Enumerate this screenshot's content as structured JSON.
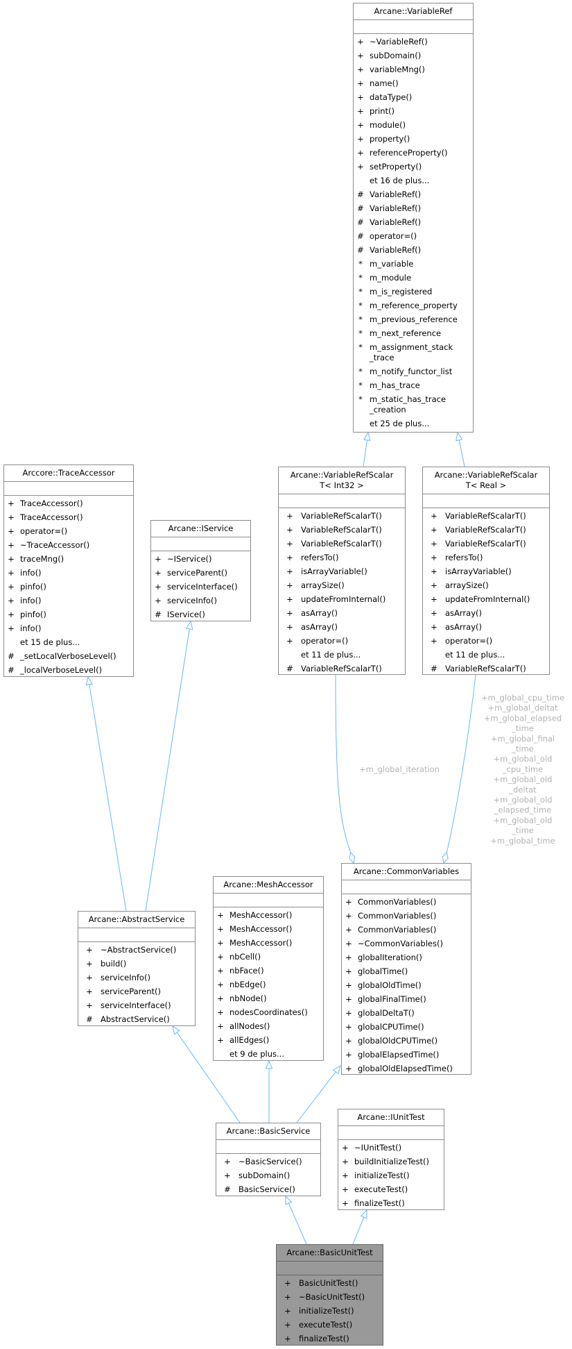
{
  "colors": {
    "edge": "#63b8ff",
    "focus_fill": "#999999",
    "border": "#8c8c8c",
    "label": "#b3b3b3"
  },
  "classes": {
    "variable_ref": {
      "title": "Arcane::VariableRef",
      "members": [
        [
          "+",
          "~VariableRef()"
        ],
        [
          "+",
          "subDomain()"
        ],
        [
          "+",
          "variableMng()"
        ],
        [
          "+",
          "name()"
        ],
        [
          "+",
          "dataType()"
        ],
        [
          "+",
          "print()"
        ],
        [
          "+",
          "module()"
        ],
        [
          "+",
          "property()"
        ],
        [
          "+",
          "referenceProperty()"
        ],
        [
          "+",
          "setProperty()"
        ],
        [
          "",
          "et 16 de plus..."
        ],
        [
          "#",
          "VariableRef()"
        ],
        [
          "#",
          "VariableRef()"
        ],
        [
          "#",
          "VariableRef()"
        ],
        [
          "#",
          "operator=()"
        ],
        [
          "#",
          "VariableRef()"
        ],
        [
          "*",
          "m_variable"
        ],
        [
          "*",
          "m_module"
        ],
        [
          "*",
          "m_is_registered"
        ],
        [
          "*",
          "m_reference_property"
        ],
        [
          "*",
          "m_previous_reference"
        ],
        [
          "*",
          "m_next_reference"
        ],
        [
          "*",
          "m_assignment_stack\n_trace"
        ],
        [
          "*",
          "m_notify_functor_list"
        ],
        [
          "*",
          "m_has_trace"
        ],
        [
          "*",
          "m_static_has_trace\n_creation"
        ],
        [
          "",
          "et 25 de plus..."
        ]
      ]
    },
    "scalar_int32": {
      "title": "Arcane::VariableRefScalar\nT< Int32 >",
      "members": [
        [
          "+",
          "VariableRefScalarT()"
        ],
        [
          "+",
          "VariableRefScalarT()"
        ],
        [
          "+",
          "VariableRefScalarT()"
        ],
        [
          "+",
          "refersTo()"
        ],
        [
          "+",
          "isArrayVariable()"
        ],
        [
          "+",
          "arraySize()"
        ],
        [
          "+",
          "updateFromInternal()"
        ],
        [
          "+",
          "asArray()"
        ],
        [
          "+",
          "asArray()"
        ],
        [
          "+",
          "operator=()"
        ],
        [
          "",
          "et 11 de plus..."
        ],
        [
          "#",
          "VariableRefScalarT()"
        ]
      ]
    },
    "scalar_real": {
      "title": "Arcane::VariableRefScalar\nT< Real >",
      "members": [
        [
          "+",
          "VariableRefScalarT()"
        ],
        [
          "+",
          "VariableRefScalarT()"
        ],
        [
          "+",
          "VariableRefScalarT()"
        ],
        [
          "+",
          "refersTo()"
        ],
        [
          "+",
          "isArrayVariable()"
        ],
        [
          "+",
          "arraySize()"
        ],
        [
          "+",
          "updateFromInternal()"
        ],
        [
          "+",
          "asArray()"
        ],
        [
          "+",
          "asArray()"
        ],
        [
          "+",
          "operator=()"
        ],
        [
          "",
          "et 11 de plus..."
        ],
        [
          "#",
          "VariableRefScalarT()"
        ]
      ]
    },
    "trace_accessor": {
      "title": "Arccore::TraceAccessor",
      "members": [
        [
          "+",
          "TraceAccessor()"
        ],
        [
          "+",
          "TraceAccessor()"
        ],
        [
          "+",
          "operator=()"
        ],
        [
          "+",
          "~TraceAccessor()"
        ],
        [
          "+",
          "traceMng()"
        ],
        [
          "+",
          "info()"
        ],
        [
          "+",
          "pinfo()"
        ],
        [
          "+",
          "info()"
        ],
        [
          "+",
          "pinfo()"
        ],
        [
          "+",
          "info()"
        ],
        [
          "",
          "et 15 de plus..."
        ],
        [
          "#",
          "_setLocalVerboseLevel()"
        ],
        [
          "#",
          "_localVerboseLevel()"
        ]
      ]
    },
    "iservice": {
      "title": "Arcane::IService",
      "members": [
        [
          "+",
          "~IService()"
        ],
        [
          "+",
          "serviceParent()"
        ],
        [
          "+",
          "serviceInterface()"
        ],
        [
          "+",
          "serviceInfo()"
        ],
        [
          "#",
          "IService()"
        ]
      ]
    },
    "common_variables": {
      "title": "Arcane::CommonVariables",
      "members": [
        [
          "+",
          "CommonVariables()"
        ],
        [
          "+",
          "CommonVariables()"
        ],
        [
          "+",
          "CommonVariables()"
        ],
        [
          "+",
          "~CommonVariables()"
        ],
        [
          "+",
          "globalIteration()"
        ],
        [
          "+",
          "globalTime()"
        ],
        [
          "+",
          "globalOldTime()"
        ],
        [
          "+",
          "globalFinalTime()"
        ],
        [
          "+",
          "globalDeltaT()"
        ],
        [
          "+",
          "globalCPUTime()"
        ],
        [
          "+",
          "globalOldCPUTime()"
        ],
        [
          "+",
          "globalElapsedTime()"
        ],
        [
          "+",
          "globalOldElapsedTime()"
        ]
      ]
    },
    "mesh_accessor": {
      "title": "Arcane::MeshAccessor",
      "members": [
        [
          "+",
          "MeshAccessor()"
        ],
        [
          "+",
          "MeshAccessor()"
        ],
        [
          "+",
          "MeshAccessor()"
        ],
        [
          "+",
          "nbCell()"
        ],
        [
          "+",
          "nbFace()"
        ],
        [
          "+",
          "nbEdge()"
        ],
        [
          "+",
          "nbNode()"
        ],
        [
          "+",
          "nodesCoordinates()"
        ],
        [
          "+",
          "allNodes()"
        ],
        [
          "+",
          "allEdges()"
        ],
        [
          "",
          "et 9 de plus..."
        ]
      ]
    },
    "abstract_service": {
      "title": "Arcane::AbstractService",
      "members": [
        [
          "+",
          "~AbstractService()"
        ],
        [
          "+",
          "build()"
        ],
        [
          "+",
          "serviceInfo()"
        ],
        [
          "+",
          "serviceParent()"
        ],
        [
          "+",
          "serviceInterface()"
        ],
        [
          "#",
          "AbstractService()"
        ]
      ]
    },
    "basic_service": {
      "title": "Arcane::BasicService",
      "members": [
        [
          "+",
          "~BasicService()"
        ],
        [
          "+",
          "subDomain()"
        ],
        [
          "#",
          "BasicService()"
        ]
      ]
    },
    "iunit_test": {
      "title": "Arcane::IUnitTest",
      "members": [
        [
          "+",
          "~IUnitTest()"
        ],
        [
          "+",
          "buildInitializeTest()"
        ],
        [
          "+",
          "initializeTest()"
        ],
        [
          "+",
          "executeTest()"
        ],
        [
          "+",
          "finalizeTest()"
        ]
      ]
    },
    "basic_unit_test": {
      "title": "Arcane::BasicUnitTest",
      "members": [
        [
          "+",
          "BasicUnitTest()"
        ],
        [
          "+",
          "~BasicUnitTest()"
        ],
        [
          "+",
          "initializeTest()"
        ],
        [
          "+",
          "executeTest()"
        ],
        [
          "+",
          "finalizeTest()"
        ]
      ]
    }
  },
  "edge_labels": {
    "iteration": "+m_global_iteration",
    "real_members": [
      "+m_global_cpu_time",
      "+m_global_deltat",
      "+m_global_elapsed",
      "_time",
      "+m_global_final",
      "_time",
      "+m_global_old",
      "_cpu_time",
      "+m_global_old",
      "_deltat",
      "+m_global_old",
      "_elapsed_time",
      "+m_global_old",
      "_time",
      "+m_global_time"
    ]
  }
}
